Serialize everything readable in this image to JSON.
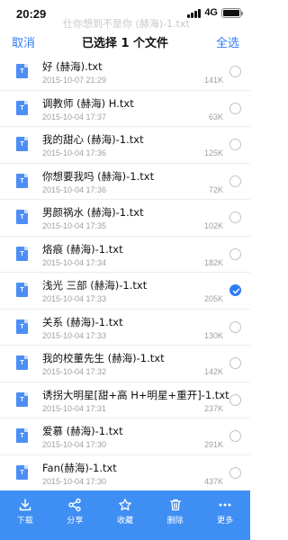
{
  "status": {
    "time": "20:29",
    "network": "4G",
    "ghost_text": "仕你想到不是你 (赫海)-1.txt"
  },
  "nav": {
    "cancel": "取消",
    "title": "已选择 1 个文件",
    "select_all": "全选"
  },
  "icon_glyph": "T",
  "files": [
    {
      "name": "好 (赫海).txt",
      "date": "2015-10-07 21:29",
      "size": "141K",
      "selected": false
    },
    {
      "name": "调教师 (赫海) H.txt",
      "date": "2015-10-04 17:37",
      "size": "63K",
      "selected": false
    },
    {
      "name": "我的甜心 (赫海)-1.txt",
      "date": "2015-10-04 17:36",
      "size": "125K",
      "selected": false
    },
    {
      "name": "你想要我吗 (赫海)-1.txt",
      "date": "2015-10-04 17:36",
      "size": "72K",
      "selected": false
    },
    {
      "name": "男颜祸水 (赫海)-1.txt",
      "date": "2015-10-04 17:35",
      "size": "102K",
      "selected": false
    },
    {
      "name": "烙痕 (赫海)-1.txt",
      "date": "2015-10-04 17:34",
      "size": "182K",
      "selected": false
    },
    {
      "name": "浅光 三部 (赫海)-1.txt",
      "date": "2015-10-04 17:33",
      "size": "205K",
      "selected": true
    },
    {
      "name": "关系 (赫海)-1.txt",
      "date": "2015-10-04 17:33",
      "size": "130K",
      "selected": false
    },
    {
      "name": "我的校董先生 (赫海)-1.txt",
      "date": "2015-10-04 17:32",
      "size": "142K",
      "selected": false
    },
    {
      "name": "诱拐大明星[甜+高 H+明星+重开]-1.txt",
      "date": "2015-10-04 17:31",
      "size": "237K",
      "selected": false
    },
    {
      "name": "爱慕 (赫海)-1.txt",
      "date": "2015-10-04 17:30",
      "size": "291K",
      "selected": false
    },
    {
      "name": "Fan(赫海)-1.txt",
      "date": "2015-10-04 17:30",
      "size": "437K",
      "selected": false
    }
  ],
  "toolbar": {
    "download": "下载",
    "share": "分享",
    "favorite": "收藏",
    "delete": "删除",
    "more": "更多"
  },
  "colors": {
    "accent": "#2f7cf6",
    "toolbar_bg": "#3f8ef3",
    "file_icon": "#4d8ef5"
  }
}
